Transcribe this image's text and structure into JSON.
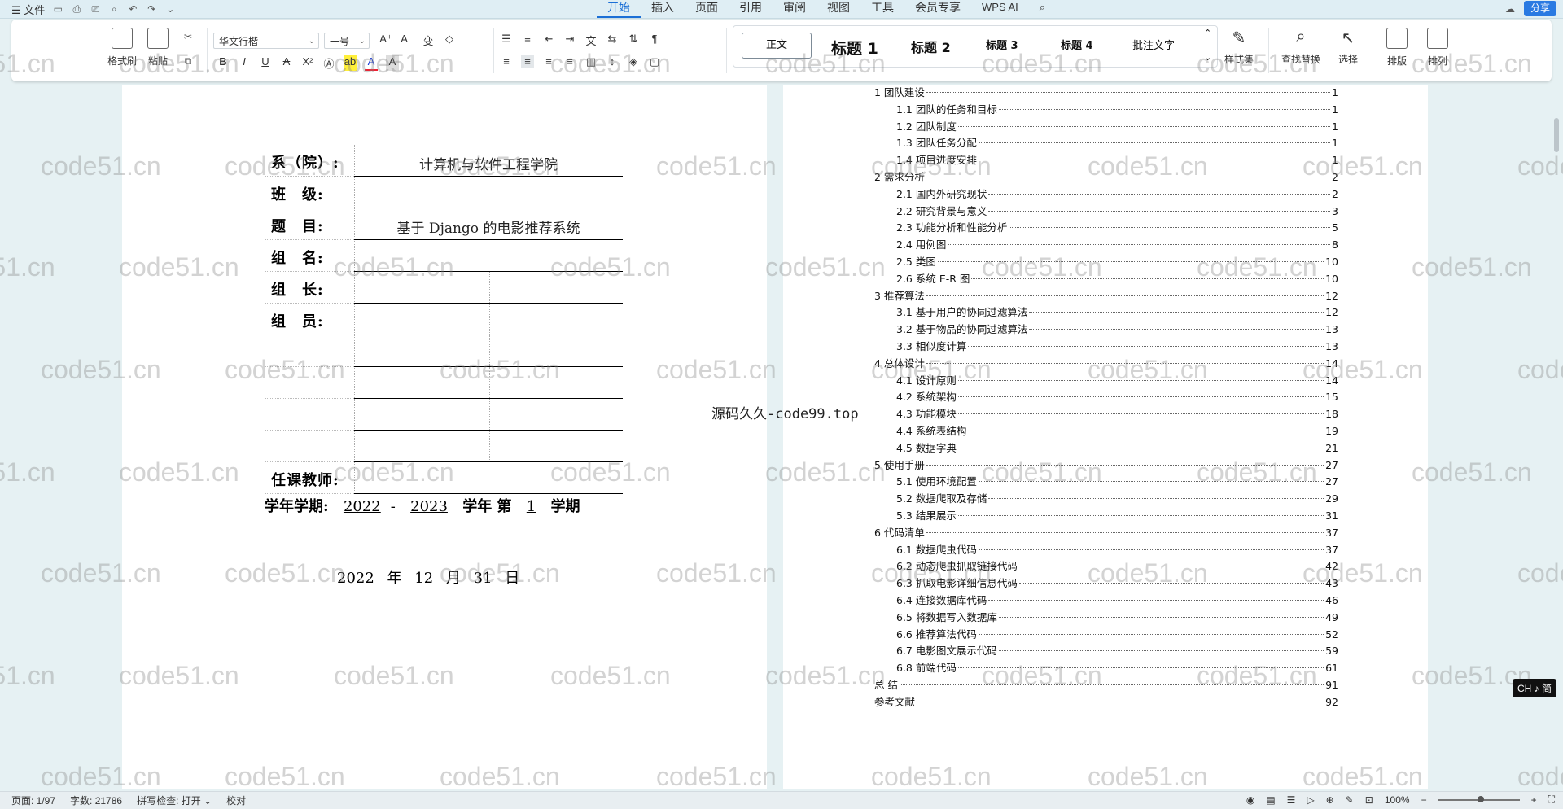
{
  "topbar": {
    "file_label": "文件",
    "tabs": [
      "开始",
      "插入",
      "页面",
      "引用",
      "审阅",
      "视图",
      "工具",
      "会员专享"
    ],
    "wps_ai": "WPS AI",
    "share_label": "分享"
  },
  "ribbon": {
    "format_painter": "格式刷",
    "paste": "粘贴",
    "font_name": "华文行楷",
    "font_size": "一号",
    "styles": [
      "正文",
      "标题 1",
      "标题 2",
      "标题 3",
      "标题 4",
      "批注文字"
    ],
    "style_set": "样式集",
    "find_replace": "查找替换",
    "select": "选择",
    "layout": "排版",
    "arrange": "排列"
  },
  "cover": {
    "rows": [
      {
        "label": "系（院）:",
        "value": "计算机与软件工程学院"
      },
      {
        "label": "班　级:",
        "value": ""
      },
      {
        "label": "题　目:",
        "value": "基于 Django 的电影推荐系统"
      },
      {
        "label": "组　名:",
        "value": ""
      },
      {
        "label": "组　长:",
        "value": ""
      },
      {
        "label": "组　员:",
        "value": ""
      },
      {
        "label": "",
        "value": ""
      },
      {
        "label": "",
        "value": ""
      },
      {
        "label": "",
        "value": ""
      },
      {
        "label": "",
        "value": ""
      },
      {
        "label": "任课教师:",
        "value": ""
      }
    ],
    "term_prefix": "学年学期:",
    "year_start": "2022",
    "dash": "-",
    "year_end": "2023",
    "term_word": "学年",
    "di": "第",
    "term_num": "1",
    "term_suffix": "学期",
    "date_year": "2022",
    "nian": "年",
    "date_month": "12",
    "yue": "月",
    "date_day": "31",
    "ri": "日"
  },
  "floating_text": "源码久久-code99.top",
  "toc": [
    {
      "level": 1,
      "title": "1 团队建设",
      "page": "1"
    },
    {
      "level": 2,
      "title": "1.1 团队的任务和目标",
      "page": "1"
    },
    {
      "level": 2,
      "title": "1.2 团队制度",
      "page": "1"
    },
    {
      "level": 2,
      "title": "1.3 团队任务分配",
      "page": "1"
    },
    {
      "level": 2,
      "title": "1.4 项目进度安排",
      "page": "1"
    },
    {
      "level": 1,
      "title": "2 需求分析",
      "page": "2"
    },
    {
      "level": 2,
      "title": "2.1 国内外研究现状",
      "page": "2"
    },
    {
      "level": 2,
      "title": "2.2 研究背景与意义",
      "page": "3"
    },
    {
      "level": 2,
      "title": "2.3 功能分析和性能分析",
      "page": "5"
    },
    {
      "level": 2,
      "title": "2.4 用例图",
      "page": "8"
    },
    {
      "level": 2,
      "title": "2.5 类图",
      "page": "10"
    },
    {
      "level": 2,
      "title": "2.6 系统 E-R 图",
      "page": "10"
    },
    {
      "level": 1,
      "title": "3 推荐算法",
      "page": "12"
    },
    {
      "level": 2,
      "title": "3.1 基于用户的协同过滤算法",
      "page": "12"
    },
    {
      "level": 2,
      "title": "3.2 基于物品的协同过滤算法",
      "page": "13"
    },
    {
      "level": 2,
      "title": "3.3 相似度计算",
      "page": "13"
    },
    {
      "level": 1,
      "title": "4 总体设计",
      "page": "14"
    },
    {
      "level": 2,
      "title": "4.1 设计原则",
      "page": "14"
    },
    {
      "level": 2,
      "title": "4.2 系统架构",
      "page": "15"
    },
    {
      "level": 2,
      "title": "4.3 功能模块",
      "page": "18"
    },
    {
      "level": 2,
      "title": "4.4 系统表结构",
      "page": "19"
    },
    {
      "level": 2,
      "title": "4.5 数据字典",
      "page": "21"
    },
    {
      "level": 1,
      "title": "5 使用手册",
      "page": "27"
    },
    {
      "level": 2,
      "title": "5.1 使用环境配置",
      "page": "27"
    },
    {
      "level": 2,
      "title": "5.2 数据爬取及存储",
      "page": "29"
    },
    {
      "level": 2,
      "title": "5.3 结果展示",
      "page": "31"
    },
    {
      "level": 1,
      "title": "6 代码清单",
      "page": "37"
    },
    {
      "level": 2,
      "title": "6.1 数据爬虫代码",
      "page": "37"
    },
    {
      "level": 2,
      "title": "6.2 动态爬虫抓取链接代码",
      "page": "42"
    },
    {
      "level": 2,
      "title": "6.3 抓取电影详细信息代码",
      "page": "43"
    },
    {
      "level": 2,
      "title": "6.4 连接数据库代码",
      "page": "46"
    },
    {
      "level": 2,
      "title": "6.5 将数据写入数据库",
      "page": "49"
    },
    {
      "level": 2,
      "title": "6.6 推荐算法代码",
      "page": "52"
    },
    {
      "level": 2,
      "title": "6.7 电影图文展示代码",
      "page": "59"
    },
    {
      "level": 2,
      "title": "6.8 前端代码",
      "page": "61"
    },
    {
      "level": 1,
      "title": "总 结",
      "page": "91"
    },
    {
      "level": 1,
      "title": "参考文献",
      "page": "92"
    }
  ],
  "watermark": "code51.cn",
  "ime": "CH ♪ 简",
  "status": {
    "page": "页面: 1/97",
    "words": "字数: 21786",
    "spell": "拼写检查: 打开",
    "proof": "校对",
    "zoom": "100%"
  }
}
